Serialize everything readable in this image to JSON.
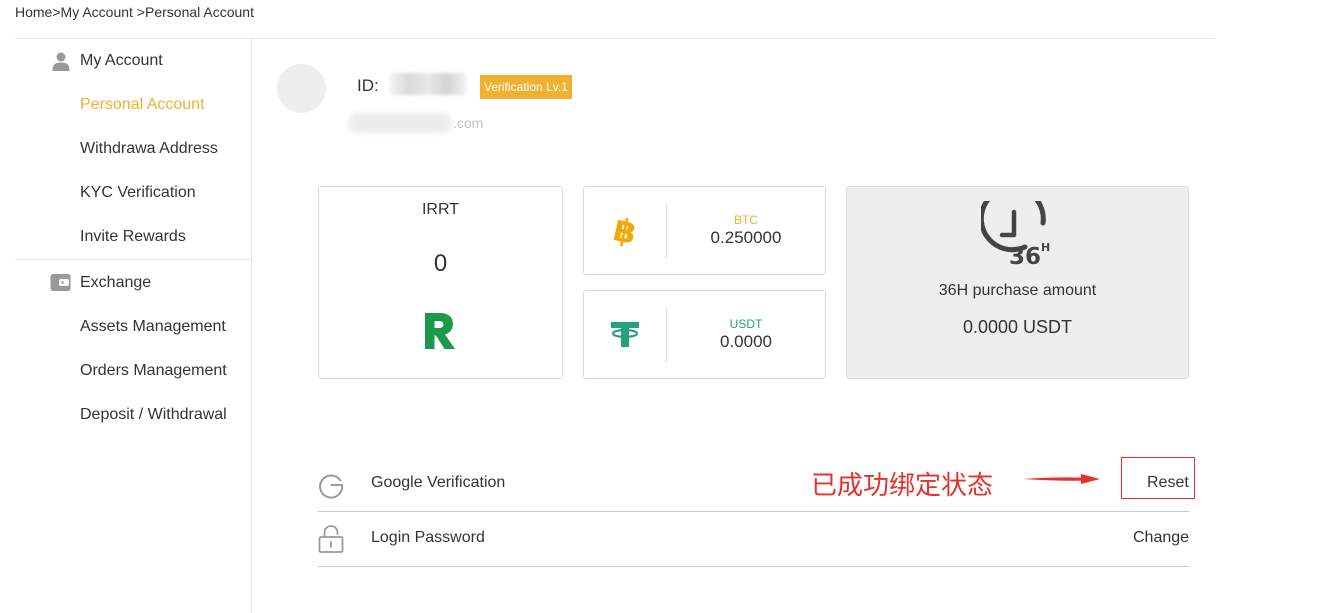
{
  "breadcrumb": {
    "home": "Home",
    "sep1": ">",
    "my_account": "My Account",
    "sep2": " >",
    "current": "Personal Account"
  },
  "sidebar": {
    "account_group": {
      "label": "My Account",
      "icon": "user-icon",
      "items": [
        {
          "label": "Personal Account",
          "active": true
        },
        {
          "label": "Withdrawa Address"
        },
        {
          "label": "KYC Verification"
        },
        {
          "label": "Invite Rewards"
        }
      ]
    },
    "exchange_group": {
      "label": "Exchange",
      "icon": "wallet-icon",
      "items": [
        {
          "label": "Assets Management"
        },
        {
          "label": "Orders Management"
        },
        {
          "label": "Deposit / Withdrawal"
        }
      ]
    }
  },
  "profile": {
    "id_label": "ID:",
    "verification_badge": "Verification Lv.1",
    "email_suffix": ".com"
  },
  "balances": {
    "irrt": {
      "symbol": "IRRT",
      "value": "0",
      "icon": "rial-icon"
    },
    "btc": {
      "symbol": "BTC",
      "value": "0.250000",
      "icon": "bitcoin-icon"
    },
    "usdt": {
      "symbol": "USDT",
      "value": "0.0000",
      "icon": "tether-icon"
    }
  },
  "purchase_36h": {
    "icon": "clock-36h-icon",
    "label": "36H purchase amount",
    "value": "0.0000 USDT"
  },
  "security": [
    {
      "label": "Google Verification",
      "icon": "google-icon",
      "action": "Reset"
    },
    {
      "label": "Login Password",
      "icon": "lock-icon",
      "action": "Change"
    }
  ],
  "annotation": {
    "text": "已成功绑定状态",
    "arrow_icon": "arrow-right-icon"
  },
  "colors": {
    "accent": "#f0b030",
    "rial_green": "#1a9a4a",
    "tether_green": "#26a17b",
    "annotation_red": "#e53030"
  }
}
